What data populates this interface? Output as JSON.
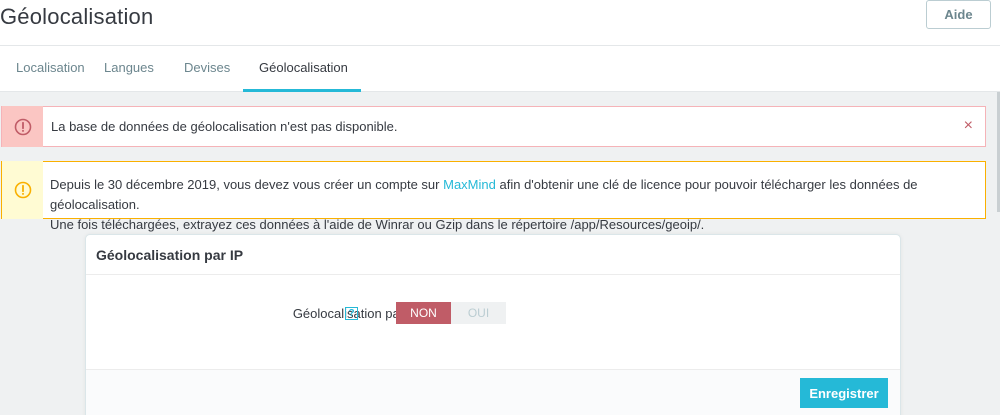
{
  "header": {
    "title": "Géolocalisation",
    "help_label": "Aide"
  },
  "tabs": [
    {
      "label": "Localisation"
    },
    {
      "label": "Langues"
    },
    {
      "label": "Devises"
    },
    {
      "label": "Géolocalisation",
      "active": true
    }
  ],
  "alerts": {
    "danger": {
      "text": "La base de données de géolocalisation n'est pas disponible.",
      "close_glyph": "×"
    },
    "warning": {
      "text_before": "Depuis le 30 décembre 2019, vous devez vous créer un compte sur",
      "link": "MaxMind",
      "text_after": "afin d'obtenir une clé de licence pour pouvoir télécharger les données de géolocalisation.",
      "line2": "Une fois téléchargées, extrayez ces données à l'aide de Winrar ou Gzip dans le répertoire /app/Resources/geoip/."
    }
  },
  "panel": {
    "title": "Géolocalisation par IP",
    "field_label": "Géolocalisation par IP",
    "help_glyph": "?",
    "switch": {
      "no": "NON",
      "yes": "OUI",
      "selected": "NON"
    },
    "save_label": "Enregistrer"
  },
  "colors": {
    "accent": "#25b9d7",
    "danger": "#c05c67",
    "warning": "#fab000"
  },
  "icons": {
    "danger": "exclamation-circle-icon",
    "warning": "exclamation-circle-icon",
    "close": "close-icon"
  }
}
